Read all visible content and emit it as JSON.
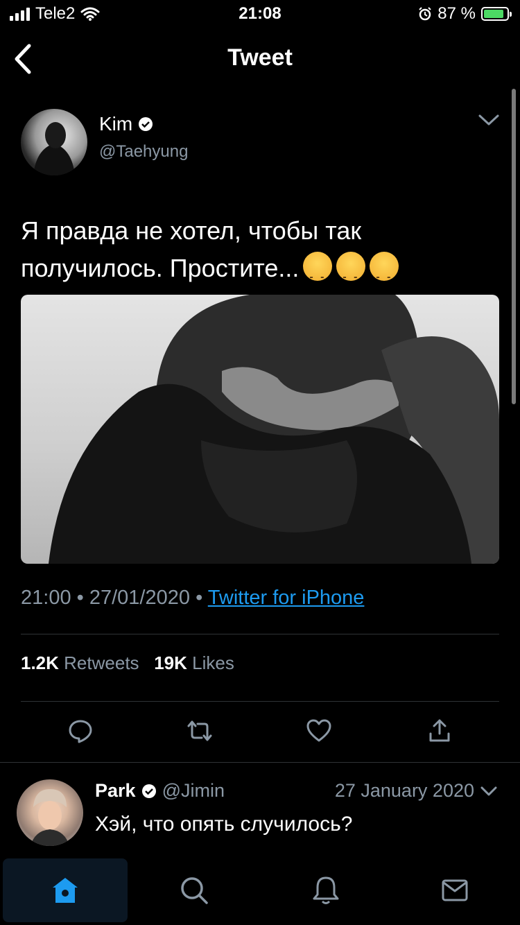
{
  "status_bar": {
    "carrier": "Tele2",
    "time": "21:08",
    "battery": "87 %"
  },
  "header": {
    "title": "Tweet"
  },
  "tweet": {
    "author_name": "Kim",
    "author_handle": "@Taehyung",
    "text_line1": "Я правда не хотел, чтобы так",
    "text_line2": "получилось. Простите...",
    "time": "21:00",
    "date": "27/01/2020",
    "source": "Twitter for iPhone",
    "retweets_count": "1.2K",
    "retweets_label": "Retweets",
    "likes_count": "19K",
    "likes_label": "Likes"
  },
  "reply": {
    "name": "Park",
    "handle": "@Jimin",
    "date": "27 January 2020",
    "text": "Хэй, что опять случилось?"
  },
  "colors": {
    "accent": "#1d9bf0",
    "muted": "#8b98a5",
    "background": "#000000"
  }
}
